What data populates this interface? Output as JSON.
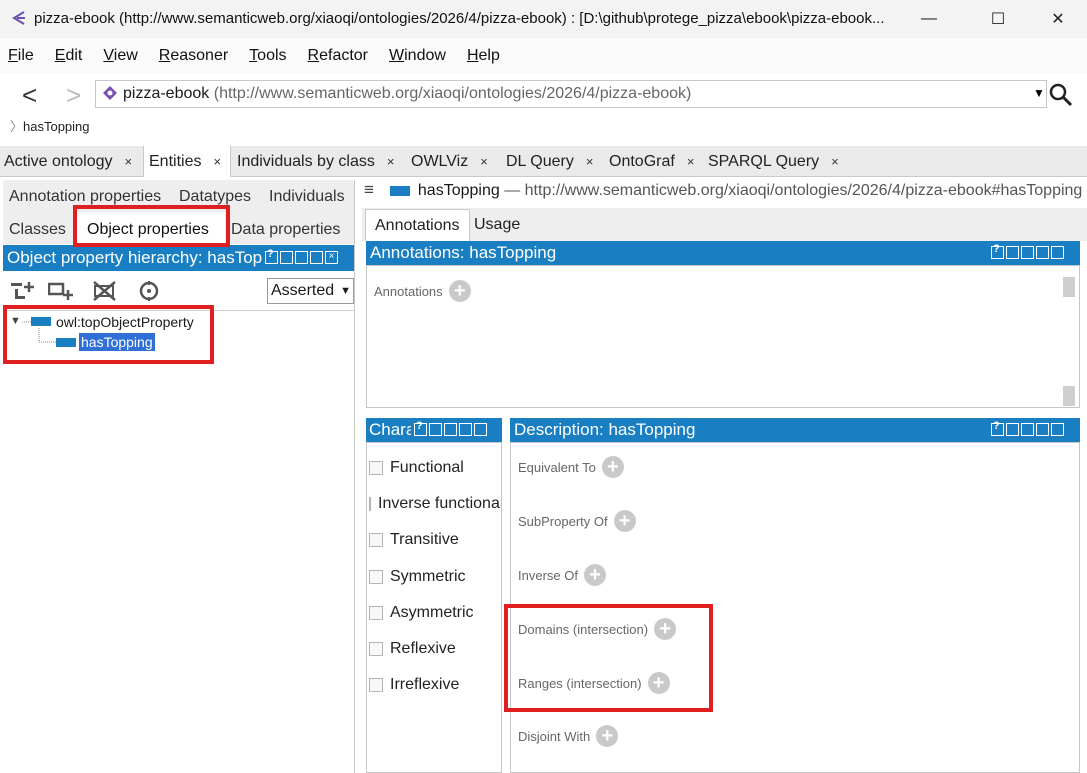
{
  "window": {
    "title": "pizza-ebook (http://www.semanticweb.org/xiaoqi/ontologies/2026/4/pizza-ebook)  : [D:\\github\\protege_pizza\\ebook\\pizza-ebook...",
    "min_symbol": "—",
    "max_symbol": "☐",
    "close_symbol": "✕"
  },
  "menu": [
    {
      "first": "F",
      "rest": "ile"
    },
    {
      "first": "E",
      "rest": "dit"
    },
    {
      "first": "V",
      "rest": "iew"
    },
    {
      "first": "R",
      "rest": "easoner"
    },
    {
      "first": "T",
      "rest": "ools"
    },
    {
      "first": "R",
      "rest": "efactor"
    },
    {
      "first": "W",
      "rest": "indow"
    },
    {
      "first": "H",
      "rest": "elp"
    }
  ],
  "nav": {
    "back": "<",
    "forward": ">",
    "ontology_name": "pizza-ebook",
    "ontology_iri": "(http://www.semanticweb.org/xiaoqi/ontologies/2026/4/pizza-ebook)",
    "breadcrumb": "hasTopping"
  },
  "tabs": [
    {
      "label": "Active ontology",
      "close": "×"
    },
    {
      "label": "Entities",
      "close": "×"
    },
    {
      "label": "Individuals by class",
      "close": "×"
    },
    {
      "label": "OWLViz",
      "close": "×"
    },
    {
      "label": "DL Query",
      "close": "×"
    },
    {
      "label": "OntoGraf",
      "close": "×"
    },
    {
      "label": "SPARQL Query",
      "close": "×"
    }
  ],
  "left": {
    "subtabs_row1": [
      "Annotation properties",
      "Datatypes",
      "Individuals"
    ],
    "subtabs_row2": [
      "Classes",
      "Object properties",
      "Data properties"
    ],
    "hierarchy_title": "Object property hierarchy: hasTopping",
    "asserted": "Asserted",
    "tree": {
      "root": "owl:topObjectProperty",
      "child": "hasTopping"
    }
  },
  "right": {
    "entity_name": "hasTopping",
    "entity_iri": "— http://www.semanticweb.org/xiaoqi/ontologies/2026/4/pizza-ebook#hasTopping",
    "tabs": [
      "Annotations",
      "Usage"
    ],
    "annotations_title": "Annotations: hasTopping",
    "annotations_label": "Annotations",
    "characteristics_title": "Characteristics",
    "characteristics": [
      "Functional",
      "Inverse functional",
      "Transitive",
      "Symmetric",
      "Asymmetric",
      "Reflexive",
      "Irreflexive"
    ],
    "description_title": "Description: hasTopping",
    "description_items": [
      "Equivalent To",
      "SubProperty Of",
      "Inverse Of",
      "Domains (intersection)",
      "Ranges (intersection)",
      "Disjoint With"
    ],
    "plus": "+"
  },
  "colors": {
    "header_blue": "#1a7fc2",
    "highlight_red": "#e02020",
    "selection_blue": "#2f6fd6"
  }
}
